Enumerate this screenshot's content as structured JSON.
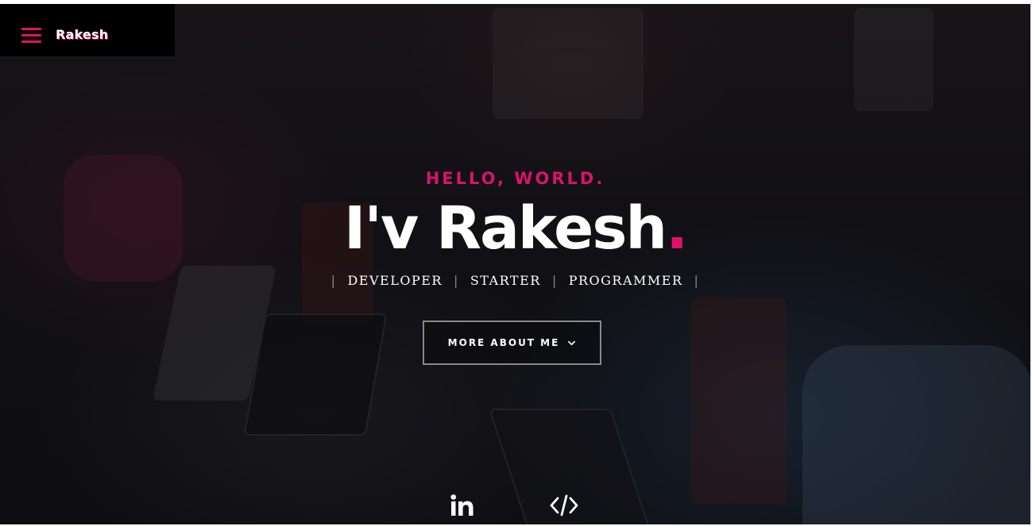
{
  "nav": {
    "brand": "Rakesh",
    "menu_icon": "hamburger-menu-icon",
    "accent_color": "#e5106a"
  },
  "hero": {
    "greeting": "HELLO, WORLD.",
    "headline_text": "I'v Rakesh",
    "headline_dot": ".",
    "roles": [
      "DEVELOPER",
      "STARTER",
      "PROGRAMMER"
    ],
    "separator": "|",
    "more_button_label": "MORE ABOUT ME",
    "more_button_icon": "chevron-down-icon"
  },
  "social": [
    {
      "icon": "linkedin-icon",
      "label": "in"
    },
    {
      "icon": "code-icon",
      "label": "</>"
    }
  ],
  "colors": {
    "accent": "#e5106a",
    "text": "#ffffff",
    "nav_bg": "#000000"
  }
}
